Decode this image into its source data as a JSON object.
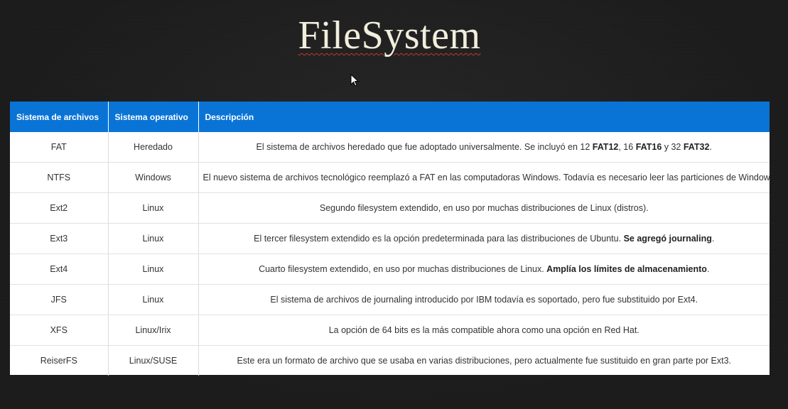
{
  "title": "FileSystem",
  "colors": {
    "header_bg": "#0a74d6",
    "page_bg": "#1b1b1b",
    "title_color": "#f1eedd"
  },
  "table": {
    "headers": [
      "Sistema de archivos",
      "Sistema operativo",
      "Descripción"
    ],
    "rows": [
      {
        "fs": "FAT",
        "os": "Heredado",
        "desc": [
          {
            "t": "El sistema de archivos heredado que fue adoptado universalmente. Se incluyó en 12 "
          },
          {
            "t": "FAT12",
            "b": true
          },
          {
            "t": ", 16 "
          },
          {
            "t": "FAT16",
            "b": true
          },
          {
            "t": " y 32 "
          },
          {
            "t": "FAT32",
            "b": true
          },
          {
            "t": "."
          }
        ]
      },
      {
        "fs": "NTFS",
        "os": "Windows",
        "desc": [
          {
            "t": "El nuevo sistema de archivos tecnológico reemplazó a FAT en las computadoras Windows. Todavía es necesario leer las particiones de Windows."
          }
        ]
      },
      {
        "fs": "Ext2",
        "os": "Linux",
        "desc": [
          {
            "t": "Segundo filesystem extendido, en uso por muchas distribuciones de Linux (distros)."
          }
        ]
      },
      {
        "fs": "Ext3",
        "os": "Linux",
        "desc": [
          {
            "t": "El tercer filesystem extendido es la opción predeterminada para las distribuciones de Ubuntu. "
          },
          {
            "t": "Se agregó journaling",
            "b": true
          },
          {
            "t": "."
          }
        ]
      },
      {
        "fs": "Ext4",
        "os": "Linux",
        "desc": [
          {
            "t": "Cuarto filesystem extendido, en uso por muchas distribuciones de Linux. "
          },
          {
            "t": "Amplía los límites de almacenamiento",
            "b": true
          },
          {
            "t": "."
          }
        ]
      },
      {
        "fs": "JFS",
        "os": "Linux",
        "desc": [
          {
            "t": "El sistema de archivos de journaling introducido por IBM todavía es soportado, pero fue substituido por Ext4."
          }
        ]
      },
      {
        "fs": "XFS",
        "os": "Linux/Irix",
        "desc": [
          {
            "t": "La opción de 64 bits es la más compatible ahora como una opción en Red Hat."
          }
        ]
      },
      {
        "fs": "ReiserFS",
        "os": "Linux/SUSE",
        "desc": [
          {
            "t": "Este era un formato de archivo que se usaba en varias distribuciones, pero actualmente fue sustituido en gran parte por Ext3."
          }
        ]
      }
    ]
  }
}
